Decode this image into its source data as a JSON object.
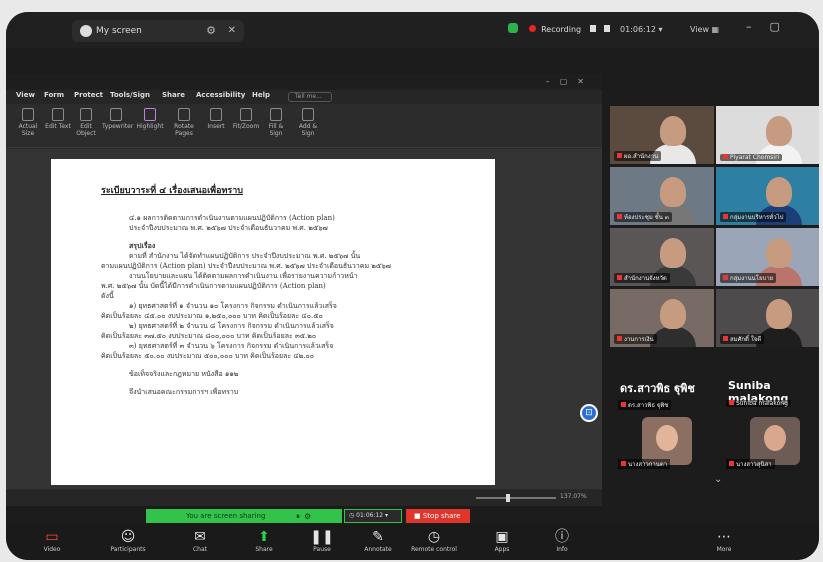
{
  "window": {
    "tab_title": "My screen",
    "recording": "Recording",
    "timer": "01:06:12",
    "view": "View"
  },
  "app": {
    "title_bar": "",
    "menus": [
      "View",
      "Form",
      "Protect",
      "Tools/Sign",
      "Share",
      "Accessibility",
      "Help"
    ],
    "search_placeholder": "Tell me...",
    "ribbon": [
      "Actual Size",
      "Edit Text",
      "Edit Object",
      "Typewriter",
      "Highlight",
      "Rotate Pages",
      "Insert",
      "Fit/Zoom",
      "Fill & Sign",
      "Add & Sign"
    ],
    "zoom": "137.07%"
  },
  "document": {
    "heading": "ระเบียบวาระที่ ๔ เรื่องเสนอเพื่อทราบ",
    "lines": [
      "๔.๑ ผลการติดตามการดำเนินงานตามแผนปฏิบัติการ (Action plan)",
      "ประจำปีงบประมาณ พ.ศ. ๒๕๖๗ ประจำเดือนธันวาคม พ.ศ. ๒๕๖๗",
      "สรุปเรื่อง",
      "ตามที่ สำนักงาน ได้จัดทำแผนปฏิบัติการ ประจำปีงบประมาณ พ.ศ. ๒๕๖๗ นั้น",
      "ตามแผนปฏิบัติการ (Action plan) ประจำปีงบประมาณ พ.ศ. ๒๕๖๗ ประจำเดือนธันวาคม ๒๕๖๗",
      "งานนโยบายและแผน ได้ติดตามผลการดำเนินงาน เพื่อรายงานความก้าวหน้า",
      "พ.ศ. ๒๕๖๗ นั้น บัดนี้ได้มีการดำเนินการตามแผนปฏิบัติการ (Action plan)",
      "ดังนี้",
      "๑) ยุทธศาสตร์ที่ ๑ จำนวน ๑๐ โครงการ กิจกรรม ดำเนินการแล้วเสร็จ",
      "คิดเป็นร้อยละ ๔๕.๐๐ งบประมาณ ๑,๒๕๐,๐๐๐ บาท คิดเป็นร้อยละ ๔๐.๕๐",
      "๒) ยุทธศาสตร์ที่ ๒ จำนวน ๘ โครงการ กิจกรรม ดำเนินการแล้วเสร็จ",
      "คิดเป็นร้อยละ ๓๗.๕๐ งบประมาณ ๘๐๐,๐๐๐ บาท คิดเป็นร้อยละ ๓๕.๒๐",
      "๓) ยุทธศาสตร์ที่ ๓ จำนวน ๖ โครงการ กิจกรรม ดำเนินการแล้วเสร็จ",
      "คิดเป็นร้อยละ ๕๐.๐๐ งบประมาณ ๕๐๐,๐๐๐ บาท คิดเป็นร้อยละ ๔๒.๐๐",
      "ข้อเท็จจริงและกฎหมาย หนังสือ ๑๑๒",
      "จึงนำเสนอคณะกรรมการฯ เพื่อทราบ"
    ]
  },
  "participants": [
    {
      "name": "ผอ.สำนักงาน"
    },
    {
      "name": "Piyarat Chomsiri"
    },
    {
      "name": "ห้องประชุม ชั้น ๓"
    },
    {
      "name": "กลุ่มงานบริหารทั่วไป"
    },
    {
      "name": "สำนักงานจังหวัด"
    },
    {
      "name": "กลุ่มงานนโยบาย"
    },
    {
      "name": "งานการเงิน"
    },
    {
      "name": "สมศักดิ์ ใจดี"
    }
  ],
  "big_names": [
    "ดร.สาวพิธ ฐุพิช",
    "Suniba malakong"
  ],
  "small_names": [
    "ดร.สาวพิธ ฐุพิช",
    "Suniba malakong",
    "นางสาวกานดา",
    "นางสาวสุนิสา"
  ],
  "sharing": {
    "status": "You are screen sharing",
    "timer": "01:06:12",
    "stop": "Stop share"
  },
  "toolbar": [
    {
      "label": "Video",
      "icon": "video-icon",
      "glyph": "▭"
    },
    {
      "label": "Participants",
      "icon": "people-icon",
      "glyph": "☺"
    },
    {
      "label": "Chat",
      "icon": "chat-icon",
      "glyph": "✉"
    },
    {
      "label": "Share",
      "icon": "share-icon",
      "glyph": "⬆"
    },
    {
      "label": "Pause",
      "icon": "pause-icon",
      "glyph": "❚❚"
    },
    {
      "label": "Annotate",
      "icon": "annotate-icon",
      "glyph": "✎"
    },
    {
      "label": "Remote control",
      "icon": "remote-icon",
      "glyph": "◷"
    },
    {
      "label": "Apps",
      "icon": "apps-icon",
      "glyph": "▣"
    },
    {
      "label": "Info",
      "icon": "info-icon",
      "glyph": "ⓘ"
    },
    {
      "label": "More",
      "icon": "more-icon",
      "glyph": "⋯"
    }
  ],
  "colors": {
    "share_green": "#33c24a",
    "stop_red": "#e0352b",
    "active_border": "#3ec46d"
  }
}
